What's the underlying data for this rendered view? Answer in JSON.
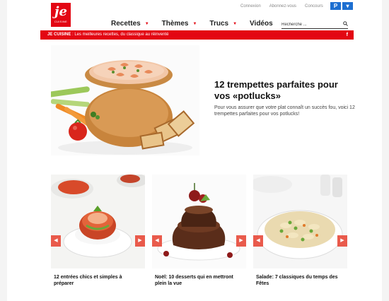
{
  "logo": {
    "main": "je",
    "sub": "CUISINE"
  },
  "toplinks": [
    "Connexion",
    "Abonnez-vous",
    "Concours"
  ],
  "social": [
    "P",
    "▾"
  ],
  "nav": [
    {
      "label": "Recettes",
      "caret": true
    },
    {
      "label": "Thèmes",
      "caret": true
    },
    {
      "label": "Trucs",
      "caret": true
    },
    {
      "label": "Vidéos",
      "caret": false
    }
  ],
  "search": {
    "placeholder": "Recherche ..."
  },
  "banner": {
    "brand": "JE CUISINE",
    "tagline": " : Les meilleures recettes, du classique au réinventé",
    "fb": "f"
  },
  "hero": {
    "title": "12 trempettes parfaites pour vos «potlucks»",
    "description": "Pour vous assurer que votre plat connaît un succès fou, voici 12 trempettes parfaites pour vos potlucks!"
  },
  "cards": [
    {
      "caption": "12 entrées chics et simples à préparer"
    },
    {
      "caption": "Noël: 10 desserts qui en mettront plein la vue"
    },
    {
      "caption": "Salade: 7 classiques du temps des Fêtes"
    }
  ],
  "arrows": {
    "left": "◀",
    "right": "▶"
  },
  "colors": {
    "brand_red": "#e30613",
    "social_blue": "#1d6fd1"
  }
}
